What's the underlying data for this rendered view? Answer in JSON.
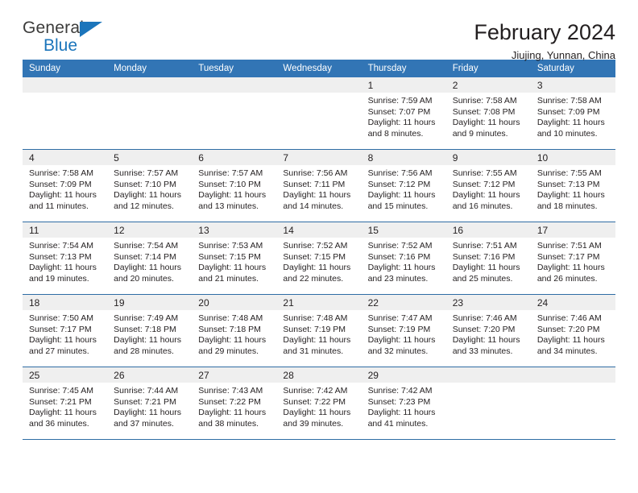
{
  "brand": {
    "name_top": "General",
    "name_bottom": "Blue",
    "triangle_color": "#1b75bb"
  },
  "header": {
    "title": "February 2024",
    "subtitle": "Jiujing, Yunnan, China"
  },
  "theme": {
    "header_bar": "#3275b5",
    "row_divider": "#2e6da4",
    "daynum_strip": "#efefef",
    "text": "#231f20"
  },
  "weekday_headers": [
    "Sunday",
    "Monday",
    "Tuesday",
    "Wednesday",
    "Thursday",
    "Friday",
    "Saturday"
  ],
  "labels": {
    "sunrise_prefix": "Sunrise: ",
    "sunset_prefix": "Sunset: ",
    "daylight_prefix": "Daylight: "
  },
  "weeks": [
    [
      {
        "day": "",
        "empty": true
      },
      {
        "day": "",
        "empty": true
      },
      {
        "day": "",
        "empty": true
      },
      {
        "day": "",
        "empty": true
      },
      {
        "day": "1",
        "sunrise": "Sunrise: 7:59 AM",
        "sunset": "Sunset: 7:07 PM",
        "daylight": "Daylight: 11 hours and 8 minutes."
      },
      {
        "day": "2",
        "sunrise": "Sunrise: 7:58 AM",
        "sunset": "Sunset: 7:08 PM",
        "daylight": "Daylight: 11 hours and 9 minutes."
      },
      {
        "day": "3",
        "sunrise": "Sunrise: 7:58 AM",
        "sunset": "Sunset: 7:09 PM",
        "daylight": "Daylight: 11 hours and 10 minutes."
      }
    ],
    [
      {
        "day": "4",
        "sunrise": "Sunrise: 7:58 AM",
        "sunset": "Sunset: 7:09 PM",
        "daylight": "Daylight: 11 hours and 11 minutes."
      },
      {
        "day": "5",
        "sunrise": "Sunrise: 7:57 AM",
        "sunset": "Sunset: 7:10 PM",
        "daylight": "Daylight: 11 hours and 12 minutes."
      },
      {
        "day": "6",
        "sunrise": "Sunrise: 7:57 AM",
        "sunset": "Sunset: 7:10 PM",
        "daylight": "Daylight: 11 hours and 13 minutes."
      },
      {
        "day": "7",
        "sunrise": "Sunrise: 7:56 AM",
        "sunset": "Sunset: 7:11 PM",
        "daylight": "Daylight: 11 hours and 14 minutes."
      },
      {
        "day": "8",
        "sunrise": "Sunrise: 7:56 AM",
        "sunset": "Sunset: 7:12 PM",
        "daylight": "Daylight: 11 hours and 15 minutes."
      },
      {
        "day": "9",
        "sunrise": "Sunrise: 7:55 AM",
        "sunset": "Sunset: 7:12 PM",
        "daylight": "Daylight: 11 hours and 16 minutes."
      },
      {
        "day": "10",
        "sunrise": "Sunrise: 7:55 AM",
        "sunset": "Sunset: 7:13 PM",
        "daylight": "Daylight: 11 hours and 18 minutes."
      }
    ],
    [
      {
        "day": "11",
        "sunrise": "Sunrise: 7:54 AM",
        "sunset": "Sunset: 7:13 PM",
        "daylight": "Daylight: 11 hours and 19 minutes."
      },
      {
        "day": "12",
        "sunrise": "Sunrise: 7:54 AM",
        "sunset": "Sunset: 7:14 PM",
        "daylight": "Daylight: 11 hours and 20 minutes."
      },
      {
        "day": "13",
        "sunrise": "Sunrise: 7:53 AM",
        "sunset": "Sunset: 7:15 PM",
        "daylight": "Daylight: 11 hours and 21 minutes."
      },
      {
        "day": "14",
        "sunrise": "Sunrise: 7:52 AM",
        "sunset": "Sunset: 7:15 PM",
        "daylight": "Daylight: 11 hours and 22 minutes."
      },
      {
        "day": "15",
        "sunrise": "Sunrise: 7:52 AM",
        "sunset": "Sunset: 7:16 PM",
        "daylight": "Daylight: 11 hours and 23 minutes."
      },
      {
        "day": "16",
        "sunrise": "Sunrise: 7:51 AM",
        "sunset": "Sunset: 7:16 PM",
        "daylight": "Daylight: 11 hours and 25 minutes."
      },
      {
        "day": "17",
        "sunrise": "Sunrise: 7:51 AM",
        "sunset": "Sunset: 7:17 PM",
        "daylight": "Daylight: 11 hours and 26 minutes."
      }
    ],
    [
      {
        "day": "18",
        "sunrise": "Sunrise: 7:50 AM",
        "sunset": "Sunset: 7:17 PM",
        "daylight": "Daylight: 11 hours and 27 minutes."
      },
      {
        "day": "19",
        "sunrise": "Sunrise: 7:49 AM",
        "sunset": "Sunset: 7:18 PM",
        "daylight": "Daylight: 11 hours and 28 minutes."
      },
      {
        "day": "20",
        "sunrise": "Sunrise: 7:48 AM",
        "sunset": "Sunset: 7:18 PM",
        "daylight": "Daylight: 11 hours and 29 minutes."
      },
      {
        "day": "21",
        "sunrise": "Sunrise: 7:48 AM",
        "sunset": "Sunset: 7:19 PM",
        "daylight": "Daylight: 11 hours and 31 minutes."
      },
      {
        "day": "22",
        "sunrise": "Sunrise: 7:47 AM",
        "sunset": "Sunset: 7:19 PM",
        "daylight": "Daylight: 11 hours and 32 minutes."
      },
      {
        "day": "23",
        "sunrise": "Sunrise: 7:46 AM",
        "sunset": "Sunset: 7:20 PM",
        "daylight": "Daylight: 11 hours and 33 minutes."
      },
      {
        "day": "24",
        "sunrise": "Sunrise: 7:46 AM",
        "sunset": "Sunset: 7:20 PM",
        "daylight": "Daylight: 11 hours and 34 minutes."
      }
    ],
    [
      {
        "day": "25",
        "sunrise": "Sunrise: 7:45 AM",
        "sunset": "Sunset: 7:21 PM",
        "daylight": "Daylight: 11 hours and 36 minutes."
      },
      {
        "day": "26",
        "sunrise": "Sunrise: 7:44 AM",
        "sunset": "Sunset: 7:21 PM",
        "daylight": "Daylight: 11 hours and 37 minutes."
      },
      {
        "day": "27",
        "sunrise": "Sunrise: 7:43 AM",
        "sunset": "Sunset: 7:22 PM",
        "daylight": "Daylight: 11 hours and 38 minutes."
      },
      {
        "day": "28",
        "sunrise": "Sunrise: 7:42 AM",
        "sunset": "Sunset: 7:22 PM",
        "daylight": "Daylight: 11 hours and 39 minutes."
      },
      {
        "day": "29",
        "sunrise": "Sunrise: 7:42 AM",
        "sunset": "Sunset: 7:23 PM",
        "daylight": "Daylight: 11 hours and 41 minutes."
      },
      {
        "day": "",
        "empty": true
      },
      {
        "day": "",
        "empty": true
      }
    ]
  ]
}
